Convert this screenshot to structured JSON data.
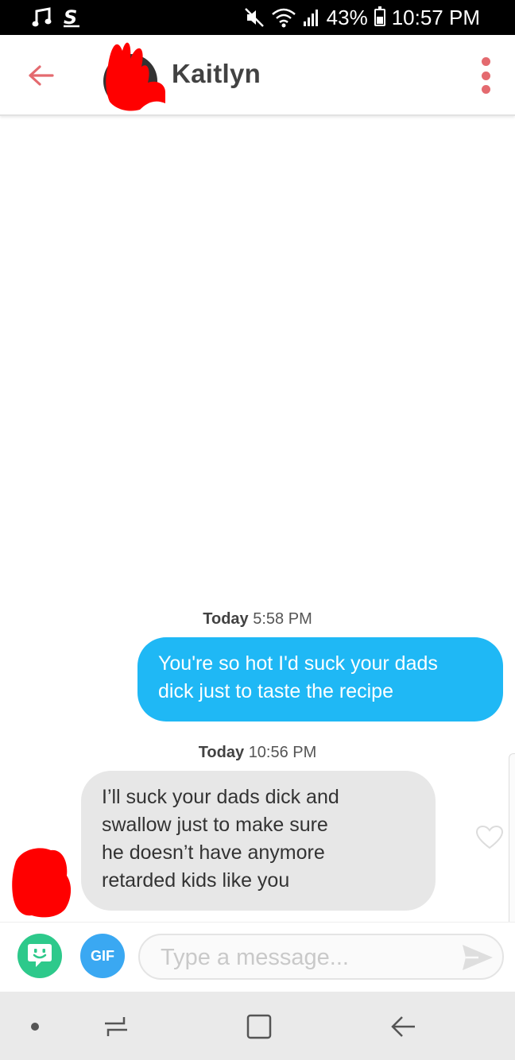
{
  "status_bar": {
    "left_icons": [
      "music-note-icon",
      "s-app-icon"
    ],
    "right_icons": [
      "mute-icon",
      "wifi-icon",
      "signal-icon",
      "battery-icon"
    ],
    "battery": "43%",
    "time": "10:57 PM"
  },
  "header": {
    "contact_name": "Kaitlyn",
    "icons": [
      "back-arrow-icon",
      "avatar",
      "more-vertical-icon"
    ]
  },
  "conversation": {
    "messages": [
      {
        "day": "Today",
        "time": "5:58 PM",
        "direction": "sent",
        "lines": [
          "You're so hot I'd suck your dads",
          "dick just to taste the recipe"
        ]
      },
      {
        "day": "Today",
        "time": "10:56 PM",
        "direction": "received",
        "lines": [
          "I’ll suck your dads dick and",
          "swallow just to make sure",
          "he doesn’t have anymore",
          "retarded kids like you"
        ]
      }
    ]
  },
  "composer": {
    "sticker_icon": "sticker-icon",
    "gif_label": "GIF",
    "placeholder": "Type a message...",
    "send_icon": "send-icon"
  },
  "nav_bar": {
    "icons": [
      "dot-icon",
      "recent-apps-icon",
      "home-icon",
      "back-icon"
    ]
  },
  "colors": {
    "accent": "#e46a6f",
    "sent_bubble": "#1fb8f5",
    "received_bubble": "#e7e7e7",
    "sticker": "#2dc98b",
    "gif": "#3aa8f2",
    "redaction": "#ff0000"
  }
}
